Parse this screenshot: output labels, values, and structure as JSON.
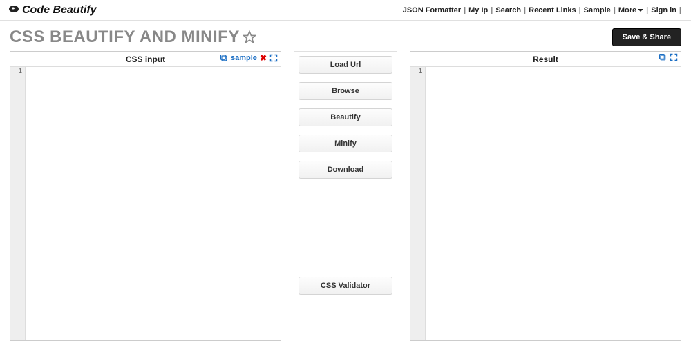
{
  "brand": {
    "name": "Code Beautify"
  },
  "nav": {
    "json_formatter": "JSON Formatter",
    "my_ip": "My Ip",
    "search": "Search",
    "recent_links": "Recent Links",
    "sample": "Sample",
    "more": "More",
    "sign_in": "Sign in"
  },
  "page": {
    "title": "CSS BEAUTIFY AND MINIFY"
  },
  "buttons": {
    "save_share": "Save & Share",
    "load_url": "Load Url",
    "browse": "Browse",
    "beautify": "Beautify",
    "minify": "Minify",
    "download": "Download",
    "css_validator": "CSS Validator"
  },
  "panels": {
    "input_title": "CSS input",
    "result_title": "Result",
    "sample_label": "sample",
    "line_one": "1"
  }
}
